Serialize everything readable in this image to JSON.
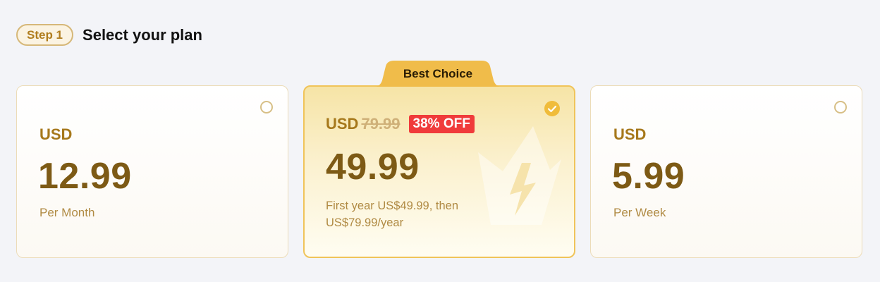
{
  "header": {
    "step_label": "Step 1",
    "title": "Select your plan"
  },
  "plans": [
    {
      "currency": "USD",
      "price": "12.99",
      "period": "Per Month",
      "selected": false
    },
    {
      "badge": "Best Choice",
      "currency": "USD",
      "original_price": "79.99",
      "discount": "38% OFF",
      "price": "49.99",
      "description": "First year US$49.99, then US$79.99/year",
      "selected": true
    },
    {
      "currency": "USD",
      "price": "5.99",
      "period": "Per Week",
      "selected": false
    }
  ],
  "colors": {
    "accent": "#f0bc3b",
    "price_text": "#7d5a15",
    "discount_badge": "#f03b3b",
    "background": "#f3f4f8"
  }
}
